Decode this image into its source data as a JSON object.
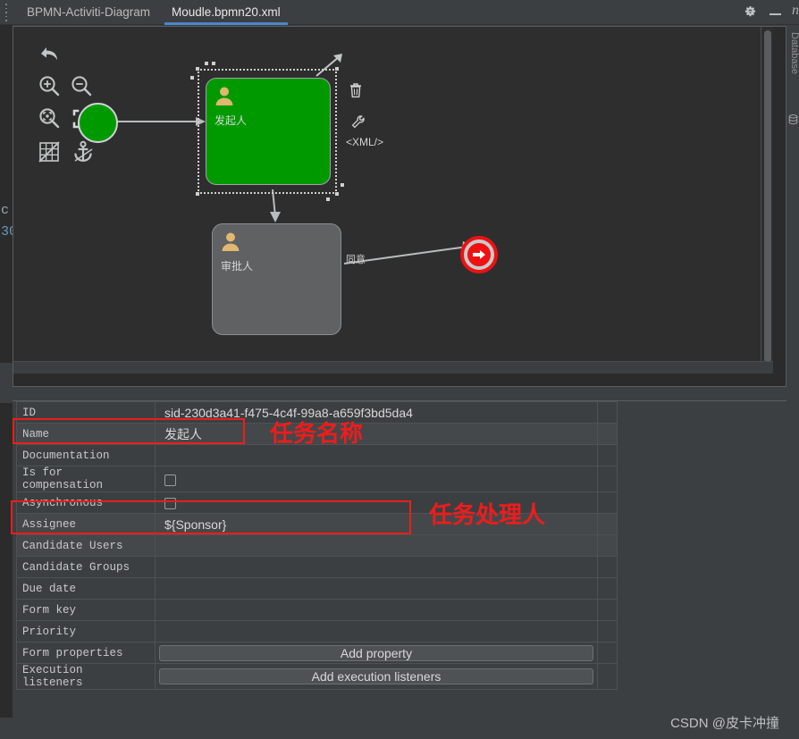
{
  "window": {
    "tabs": [
      {
        "label": "BPMN-Activiti-Diagram",
        "active": false
      },
      {
        "label": "Moudle.bpmn20.xml",
        "active": true
      }
    ],
    "gear_icon": "gear-icon",
    "minimize_icon": "minimize-icon",
    "ide_edge_letter": "n"
  },
  "ide_background": {
    "left_code_line1": "c",
    "left_code_line2": "30",
    "right_tool_label": "Database"
  },
  "toolbar": {
    "items": [
      {
        "name": "undo-icon",
        "title": "Undo"
      },
      {
        "name": "zoom-in-icon",
        "title": "Zoom in"
      },
      {
        "name": "zoom-out-icon",
        "title": "Zoom out"
      },
      {
        "name": "zoom-fit-icon",
        "title": "Zoom to fit"
      },
      {
        "name": "zoom-actual-icon",
        "title": "Actual size"
      },
      {
        "name": "grid-off-icon",
        "title": "Toggle grid"
      },
      {
        "name": "anchor-icon",
        "title": "Snap to anchor"
      }
    ]
  },
  "diagram": {
    "task_start": {
      "label": "发起人",
      "type": "user-task",
      "selected": true,
      "color": "#009A00"
    },
    "task_approve": {
      "label": "审批人",
      "type": "user-task",
      "selected": false,
      "color": "#5f6163"
    },
    "sequence_flow_label": "同意",
    "end_event": {
      "name": "end-event",
      "color": "#ee1111"
    },
    "context_menu": [
      {
        "name": "resize-arrow-icon",
        "label": ""
      },
      {
        "name": "delete-icon",
        "label": ""
      },
      {
        "name": "wrench-icon",
        "label": ""
      },
      {
        "name": "xml-link",
        "label": "<XML/>"
      }
    ]
  },
  "properties": {
    "rows": [
      {
        "label": "ID",
        "value": "sid-230d3a41-f475-4c4f-99a8-a659f3bd5da4",
        "kind": "text"
      },
      {
        "label": "Name",
        "value": "发起人",
        "kind": "text"
      },
      {
        "label": "Documentation",
        "value": "",
        "kind": "text"
      },
      {
        "label": "Is for compensation",
        "value": "",
        "kind": "checkbox"
      },
      {
        "label": "Asynchronous",
        "value": "",
        "kind": "checkbox"
      },
      {
        "label": "Assignee",
        "value": "${Sponsor}",
        "kind": "text"
      },
      {
        "label": "Candidate Users",
        "value": "",
        "kind": "text"
      },
      {
        "label": "Candidate Groups",
        "value": "",
        "kind": "text"
      },
      {
        "label": "Due date",
        "value": "",
        "kind": "text"
      },
      {
        "label": "Form key",
        "value": "",
        "kind": "text"
      },
      {
        "label": "Priority",
        "value": "",
        "kind": "text"
      },
      {
        "label": "Form properties",
        "value": "Add property",
        "kind": "button"
      },
      {
        "label": "Execution listeners",
        "value": "Add execution listeners",
        "kind": "button"
      }
    ]
  },
  "annotations": {
    "accent_color": "#ee1c1c",
    "name_note": "任务名称",
    "assignee_note": "任务处理人"
  },
  "watermark": {
    "text": "CSDN @皮卡冲撞"
  }
}
